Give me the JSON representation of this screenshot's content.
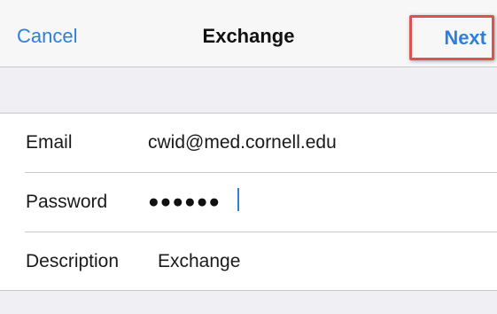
{
  "navbar": {
    "cancel_label": "Cancel",
    "title": "Exchange",
    "next_label": "Next"
  },
  "form": {
    "email": {
      "label": "Email",
      "value": "cwid@med.cornell.edu"
    },
    "password": {
      "label": "Password",
      "value": "●●●●●●"
    },
    "description": {
      "label": "Description",
      "value": "Exchange"
    }
  },
  "colors": {
    "accent": "#2f7fd9",
    "highlight": "#d9534f",
    "background": "#efeff4"
  }
}
